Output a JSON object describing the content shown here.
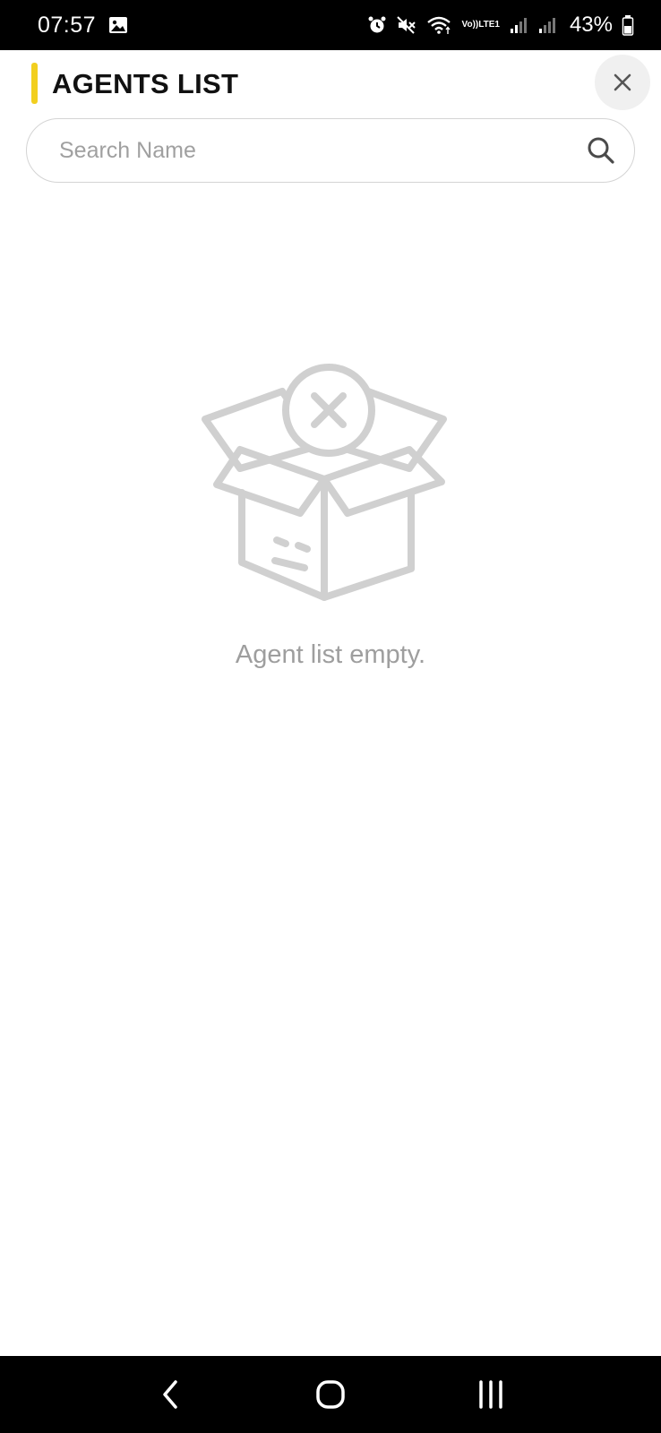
{
  "status_bar": {
    "time": "07:57",
    "battery": "43%",
    "volte_line1": "Vo))",
    "volte_line2": "LTE1",
    "icons": [
      "gallery-icon",
      "alarm-icon",
      "mute-icon",
      "wifi-icon",
      "signal-icon",
      "signal-icon",
      "battery-icon"
    ]
  },
  "header": {
    "title": "AGENTS LIST",
    "accent_color": "#f2cf1f",
    "close_icon": "close-icon"
  },
  "search": {
    "placeholder": "Search Name",
    "value": "",
    "icon": "search-icon"
  },
  "empty_state": {
    "illustration": "empty-box-icon",
    "message": "Agent list empty."
  },
  "nav_bar": {
    "buttons": [
      "back-icon",
      "home-icon",
      "recents-icon"
    ]
  }
}
